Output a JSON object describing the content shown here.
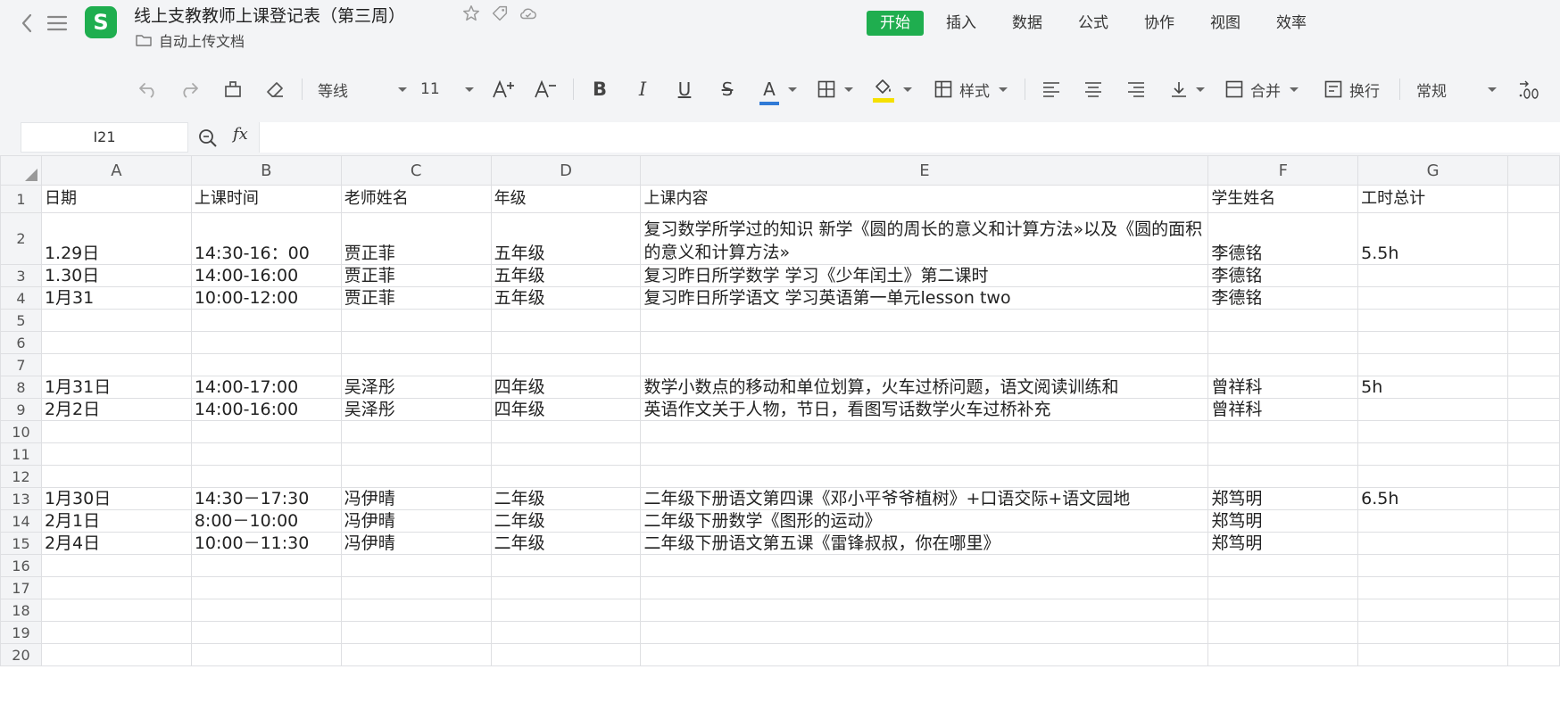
{
  "title_bar": {
    "doc_title": "线上支教教师上课登记表（第三周）",
    "folder": "自动上传文档",
    "app_logo_letter": "S",
    "menu_tabs": [
      "开始",
      "插入",
      "数据",
      "公式",
      "协作",
      "视图",
      "效率"
    ],
    "active_tab": "开始"
  },
  "toolbar": {
    "font_name": "等线",
    "font_size": "11",
    "bold": "B",
    "italic": "I",
    "underline": "U",
    "strike": "S",
    "font_color_letter": "A",
    "styles_label": "样式",
    "merge_label": "合并",
    "wrap_label": "换行",
    "number_format": "常规",
    "font_color": "#2f7ad6",
    "fill_color": "#f5e000"
  },
  "formula_bar": {
    "cell_ref": "I21",
    "fx": "fx",
    "formula": ""
  },
  "sheet": {
    "columns": [
      "A",
      "B",
      "C",
      "D",
      "E",
      "F",
      "G"
    ],
    "rows": [
      {
        "n": "1",
        "cells": [
          "日期",
          "上课时间",
          "老师姓名",
          "年级",
          "上课内容",
          "学生姓名",
          "工时总计"
        ]
      },
      {
        "n": "2",
        "cells": [
          "1.29日",
          "14:30-16：00",
          "贾正菲",
          "五年级",
          "复习数学所学过的知识 新学《圆的周长的意义和计算方法»以及《圆的面积的意义和计算方法»",
          "李德铭",
          "5.5h"
        ]
      },
      {
        "n": "3",
        "cells": [
          "1.30日",
          "14:00-16:00",
          "贾正菲",
          "五年级",
          "复习昨日所学数学 学习《少年闰土》第二课时",
          "李德铭",
          ""
        ]
      },
      {
        "n": "4",
        "cells": [
          "1月31",
          "10:00-12:00",
          "贾正菲",
          "五年级",
          "复习昨日所学语文 学习英语第一单元lesson two",
          "李德铭",
          ""
        ]
      },
      {
        "n": "5",
        "cells": [
          "",
          "",
          "",
          "",
          "",
          "",
          ""
        ]
      },
      {
        "n": "6",
        "cells": [
          "",
          "",
          "",
          "",
          "",
          "",
          ""
        ]
      },
      {
        "n": "7",
        "cells": [
          "",
          "",
          "",
          "",
          "",
          "",
          ""
        ]
      },
      {
        "n": "8",
        "cells": [
          "1月31日",
          "14:00-17:00",
          "吴泽彤",
          "四年级",
          "数学小数点的移动和单位划算，火车过桥问题，语文阅读训练和",
          "曾祥科",
          "5h"
        ]
      },
      {
        "n": "9",
        "cells": [
          "2月2日",
          "14:00-16:00",
          "吴泽彤",
          "四年级",
          "英语作文关于人物，节日，看图写话数学火车过桥补充",
          "曾祥科",
          ""
        ]
      },
      {
        "n": "10",
        "cells": [
          "",
          "",
          "",
          "",
          "",
          "",
          ""
        ]
      },
      {
        "n": "11",
        "cells": [
          "",
          "",
          "",
          "",
          "",
          "",
          ""
        ]
      },
      {
        "n": "12",
        "cells": [
          "",
          "",
          "",
          "",
          "",
          "",
          ""
        ]
      },
      {
        "n": "13",
        "cells": [
          "1月30日",
          "14:30－17:30",
          "冯伊晴",
          "二年级",
          "二年级下册语文第四课《邓小平爷爷植树》+口语交际+语文园地",
          "郑笃明",
          "6.5h"
        ]
      },
      {
        "n": "14",
        "cells": [
          "2月1日",
          "8:00－10:00",
          "冯伊晴",
          "二年级",
          "二年级下册数学《图形的运动》",
          "郑笃明",
          ""
        ]
      },
      {
        "n": "15",
        "cells": [
          "2月4日",
          "10:00－11:30",
          "冯伊晴",
          "二年级",
          "二年级下册语文第五课《雷锋叔叔，你在哪里》",
          "郑笃明",
          ""
        ]
      },
      {
        "n": "16",
        "cells": [
          "",
          "",
          "",
          "",
          "",
          "",
          ""
        ]
      },
      {
        "n": "17",
        "cells": [
          "",
          "",
          "",
          "",
          "",
          "",
          ""
        ]
      },
      {
        "n": "18",
        "cells": [
          "",
          "",
          "",
          "",
          "",
          "",
          ""
        ]
      },
      {
        "n": "19",
        "cells": [
          "",
          "",
          "",
          "",
          "",
          "",
          ""
        ]
      },
      {
        "n": "20",
        "cells": [
          "",
          "",
          "",
          "",
          "",
          "",
          ""
        ]
      }
    ]
  }
}
